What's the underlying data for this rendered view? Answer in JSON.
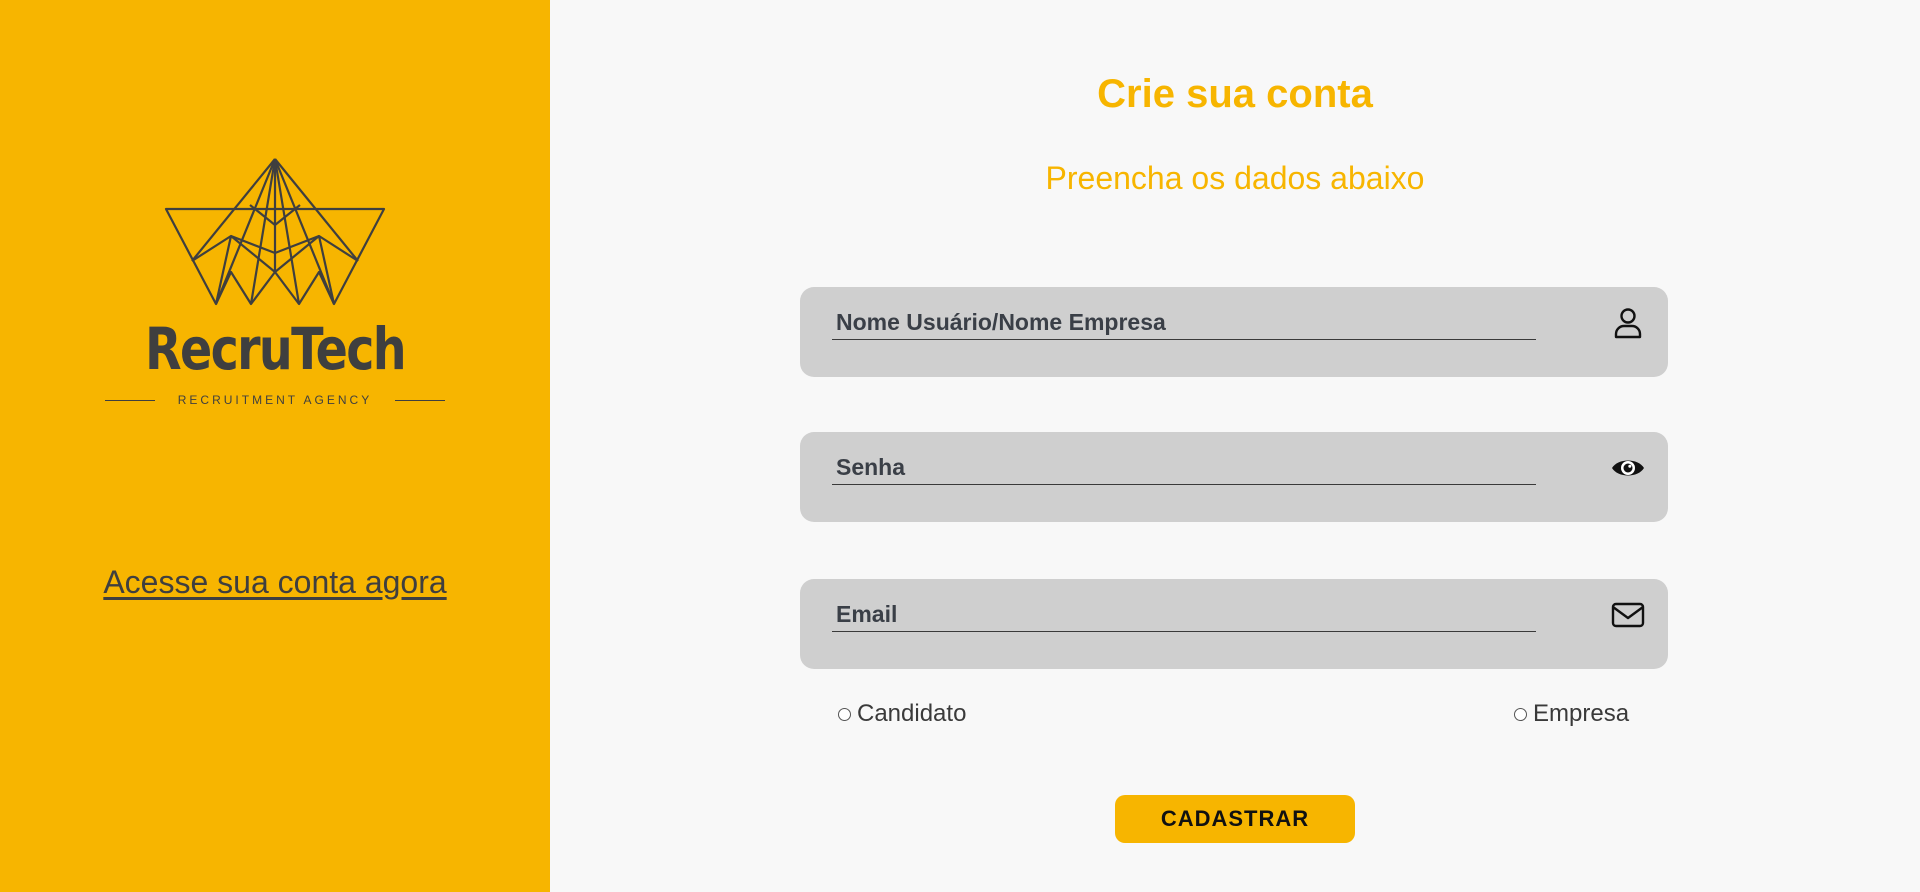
{
  "brand": {
    "name": "RecruTech",
    "tagline": "RECRUITMENT AGENCY",
    "color": "#f7b500",
    "logo_ink": "#3f3f3f"
  },
  "sidebar": {
    "login_link": "Acesse sua conta agora"
  },
  "form": {
    "title": "Crie sua conta",
    "subtitle": "Preencha os dados abaixo",
    "fields": [
      {
        "placeholder": "Nome Usuário/Nome Empresa",
        "value": "",
        "icon": "user-icon"
      },
      {
        "placeholder": "Senha",
        "value": "",
        "icon": "eye-icon"
      },
      {
        "placeholder": "Email",
        "value": "",
        "icon": "mail-icon"
      }
    ],
    "account_types": [
      {
        "label": "Candidato",
        "selected": false
      },
      {
        "label": "Empresa",
        "selected": false
      }
    ],
    "submit_label": "CADASTRAR"
  }
}
